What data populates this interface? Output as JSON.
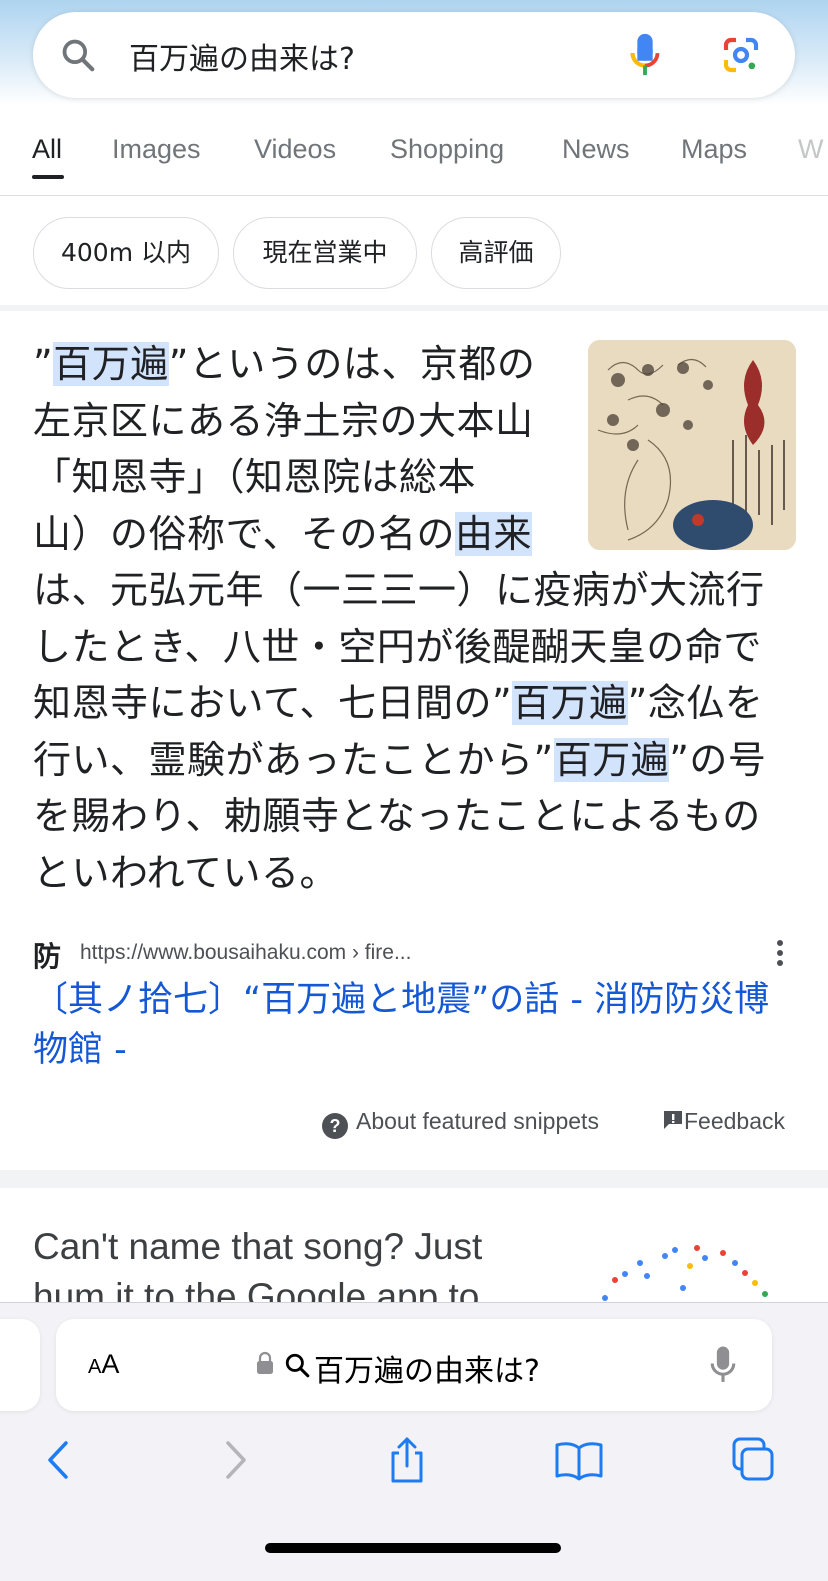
{
  "search": {
    "query": "百万遍の由来は?"
  },
  "tabs": [
    "All",
    "Images",
    "Videos",
    "Shopping",
    "News",
    "Maps",
    "W"
  ],
  "chips": [
    "400m 以内",
    "現在営業中",
    "高評価"
  ],
  "snippet": {
    "lines": [
      {
        "parts": [
          {
            "t": "”"
          },
          {
            "t": "百万遍",
            "hl": true
          },
          {
            "t": "”というのは、京都の"
          }
        ]
      },
      {
        "parts": [
          {
            "t": "左京区にある浄土宗の大本山"
          }
        ]
      },
      {
        "parts": [
          {
            "t": "「知恩寺」（知恩院は総本"
          }
        ]
      },
      {
        "parts": [
          {
            "t": "山）の俗称で、その名の"
          },
          {
            "t": "由来",
            "hl": true
          }
        ]
      },
      {
        "parts": [
          {
            "t": "は、元弘元年（一三三一）に疫病が大流行"
          }
        ]
      },
      {
        "parts": [
          {
            "t": "したとき、八世・空円が後醍醐天皇の命で"
          }
        ]
      },
      {
        "parts": [
          {
            "t": "知恩寺において、七日間の”"
          },
          {
            "t": "百万遍",
            "hl": true
          },
          {
            "t": "”念仏を"
          }
        ]
      },
      {
        "parts": [
          {
            "t": "行い、霊験があったことから”"
          },
          {
            "t": "百万遍",
            "hl": true
          },
          {
            "t": "”の号"
          }
        ]
      },
      {
        "parts": [
          {
            "t": "を賜わり、勅願寺となったことによるもの"
          }
        ]
      },
      {
        "parts": [
          {
            "t": "といわれている。"
          }
        ]
      }
    ]
  },
  "source": {
    "favicon": "防",
    "url": "https://www.bousaihaku.com › fire...",
    "title": "〔其ノ拾七〕“百万遍と地震”の話 - 消防防災博物館 -"
  },
  "footer": {
    "about": "About featured snippets",
    "feedback": "Feedback"
  },
  "promo": {
    "text": "Can't name that song? Just hum it to the Google app to"
  },
  "safari": {
    "aa": "AA",
    "address": "百万遍の由来は?"
  }
}
